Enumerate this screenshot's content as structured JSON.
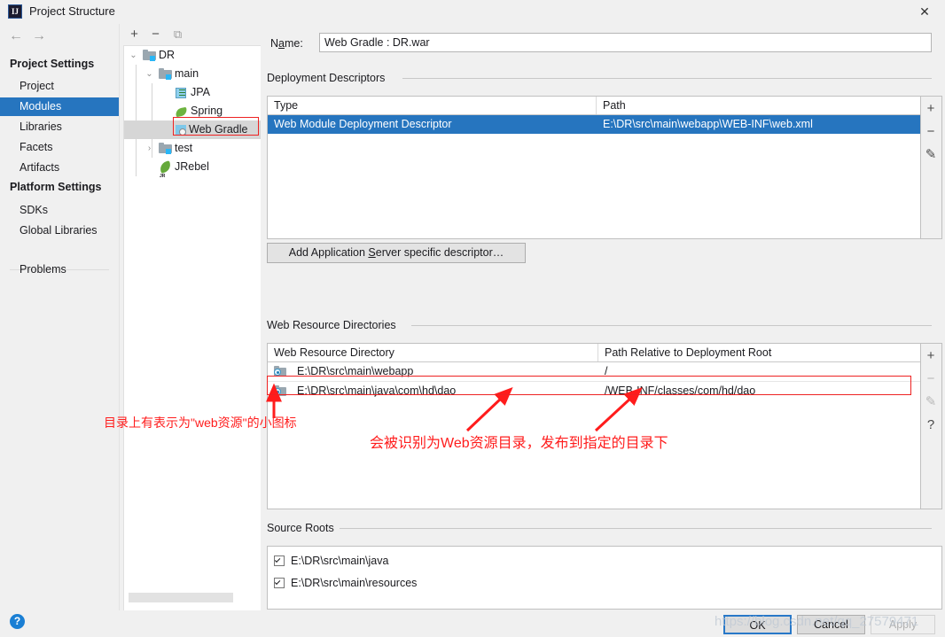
{
  "window": {
    "title": "Project Structure",
    "app_icon": "IJ",
    "close_icon": "✕"
  },
  "nav": {
    "back_icon": "←",
    "forward_icon": "→",
    "group_project_settings": "Project Settings",
    "group_platform_settings": "Platform Settings",
    "project_items": [
      {
        "label": "Project",
        "selected": false
      },
      {
        "label": "Modules",
        "selected": true
      },
      {
        "label": "Libraries",
        "selected": false
      },
      {
        "label": "Facets",
        "selected": false
      },
      {
        "label": "Artifacts",
        "selected": false
      }
    ],
    "platform_items": [
      {
        "label": "SDKs",
        "selected": false
      },
      {
        "label": "Global Libraries",
        "selected": false
      }
    ],
    "problems_label": "Problems"
  },
  "tree": {
    "toolbar": {
      "add_icon": "+",
      "remove_icon": "−",
      "copy_icon": "⧉"
    },
    "nodes": [
      {
        "label": "DR",
        "icon": "folder-module-icon",
        "twisty": "⌄",
        "depth": 0,
        "selected": false
      },
      {
        "label": "main",
        "icon": "folder-module-icon",
        "twisty": "⌄",
        "depth": 1,
        "selected": false
      },
      {
        "label": "JPA",
        "icon": "jpa-icon",
        "twisty": "",
        "depth": 2,
        "selected": false
      },
      {
        "label": "Spring",
        "icon": "spring-icon",
        "twisty": "",
        "depth": 2,
        "selected": false
      },
      {
        "label": "Web Gradle",
        "icon": "web-gradle-icon",
        "twisty": "",
        "depth": 2,
        "selected": true
      },
      {
        "label": "test",
        "icon": "folder-module-icon",
        "twisty": "›",
        "depth": 1,
        "selected": false
      },
      {
        "label": "JRebel",
        "icon": "jrebel-icon",
        "twisty": "",
        "depth": 1,
        "selected": false
      }
    ]
  },
  "main": {
    "name_label": "Name:",
    "name_value": "Web Gradle : DR.war",
    "deployment": {
      "section_title": "Deployment Descriptors",
      "columns": [
        "Type",
        "Path"
      ],
      "rows": [
        {
          "type": "Web Module Deployment Descriptor",
          "path": "E:\\DR\\src\\main\\webapp\\WEB-INF\\web.xml",
          "selected": true
        }
      ],
      "tools": [
        {
          "icon": "+",
          "name": "add-descriptor-icon",
          "disabled": false
        },
        {
          "icon": "−",
          "name": "remove-descriptor-icon",
          "disabled": false
        },
        {
          "icon": "✎",
          "name": "edit-descriptor-icon",
          "disabled": false
        }
      ],
      "add_button_label": "Add Application Server specific descriptor…"
    },
    "web_resources": {
      "section_title": "Web Resource Directories",
      "columns": [
        "Web Resource Directory",
        "Path Relative to Deployment Root"
      ],
      "rows": [
        {
          "dir": "E:\\DR\\src\\main\\webapp",
          "rel": "/",
          "highlight": false
        },
        {
          "dir": "E:\\DR\\src\\main\\java\\com\\hd\\dao",
          "rel": "/WEB-INF/classes/com/hd/dao",
          "highlight": true
        }
      ],
      "tools": [
        {
          "icon": "+",
          "name": "add-resource-icon",
          "disabled": false
        },
        {
          "icon": "−",
          "name": "remove-resource-icon",
          "disabled": true
        },
        {
          "icon": "✎",
          "name": "edit-resource-icon",
          "disabled": true
        },
        {
          "icon": "?",
          "name": "help-resource-icon",
          "disabled": false
        }
      ]
    },
    "source_roots": {
      "section_title": "Source Roots",
      "rows": [
        {
          "label": "E:\\DR\\src\\main\\java",
          "checked": true
        },
        {
          "label": "E:\\DR\\src\\main\\resources",
          "checked": true
        }
      ]
    }
  },
  "footer": {
    "help_icon": "?",
    "ok_label": "OK",
    "cancel_label": "Cancel",
    "apply_label": "Apply",
    "watermark": "https://blog.csdn.net/qq_27579471"
  },
  "annotations": {
    "color": "#ff1c1c",
    "note_icon_text": "目录上有表示为\"web资源\"的小图标",
    "note_resource_text": "会被识别为Web资源目录，发布到指定的目录下"
  }
}
